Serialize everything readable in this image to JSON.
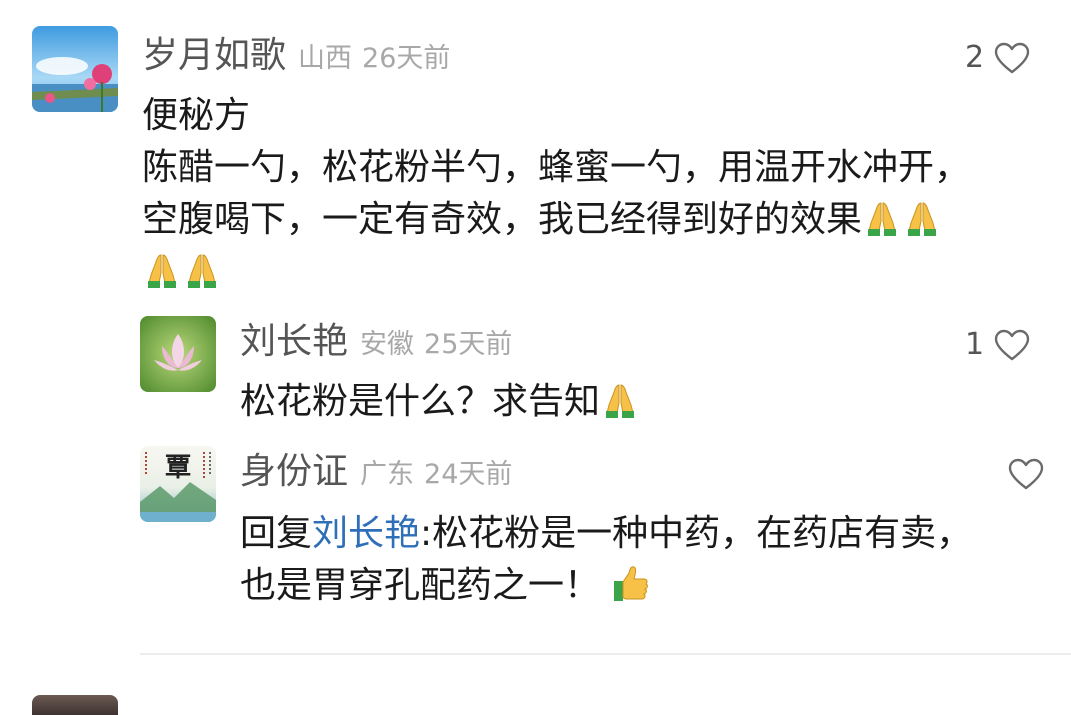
{
  "comments": [
    {
      "name": "岁月如歌",
      "region": "山西",
      "time": "26天前",
      "likes": "2",
      "avatar_icon": "flower-lake-avatar",
      "lines": [
        "便秘方",
        "陈醋一勺，松花粉半勺，蜂蜜一勺，用温开水冲开，",
        "空腹喝下，一定有奇效，我已经得到好的效果"
      ],
      "emoji": "praying-hands-icon"
    }
  ],
  "replies": [
    {
      "name": "刘长艳",
      "region": "安徽",
      "time": "25天前",
      "likes": "1",
      "avatar_icon": "lotus-avatar",
      "text": "松花粉是什么？求告知",
      "emoji": "praying-hands-icon"
    },
    {
      "name": "身份证",
      "region": "广东",
      "time": "24天前",
      "likes": "",
      "avatar_icon": "calligraphy-landscape-avatar",
      "avatar_text": "覃",
      "reply_prefix": "回复",
      "reply_to": "刘长艳",
      "reply_colon": ":",
      "lines": [
        "松花粉是一种中药，在药店有卖，",
        "也是胃穿孔配药之一！"
      ],
      "emoji": "thumbs-up-icon"
    }
  ],
  "colors": {
    "name": "#555555",
    "meta": "#a8a8a8",
    "body": "#1a1a1a",
    "reply_link": "#2f6fb8",
    "divider": "#ececec"
  }
}
